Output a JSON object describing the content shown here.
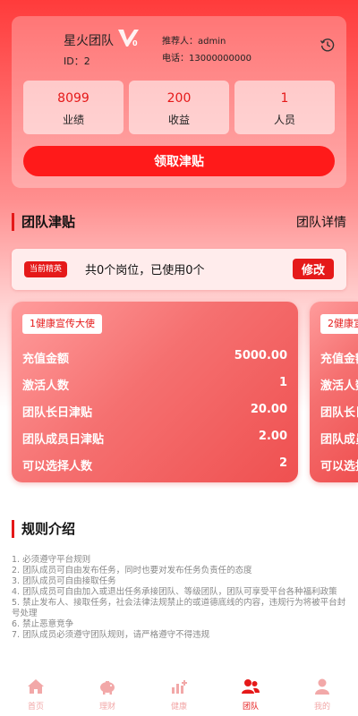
{
  "colors": {
    "primary": "#e51919",
    "button": "#ff1a1a",
    "tab_inactive": "#f2a8a8"
  },
  "header": {
    "team_name": "星火团队",
    "vip_badge": "V0",
    "team_id": "ID：2",
    "referrer": "推荐人：admin",
    "phone": "电话：13000000000",
    "history_icon": "history-clock-icon"
  },
  "stats": [
    {
      "value": "8099",
      "label": "业绩"
    },
    {
      "value": "200",
      "label": "收益"
    },
    {
      "value": "1",
      "label": "人员"
    }
  ],
  "claim_button": "领取津贴",
  "allowance_section": {
    "title": "团队津贴",
    "detail_link": "团队详情"
  },
  "quota": {
    "tag": "当前精英",
    "text": "共0个岗位，已使用0个",
    "edit_button": "修改"
  },
  "positions": [
    {
      "title": "1健康宣传大使",
      "rows": [
        {
          "key": "充值金额",
          "value": "5000.00"
        },
        {
          "key": "激活人数",
          "value": "1"
        },
        {
          "key": "团队长日津贴",
          "value": "20.00"
        },
        {
          "key": "团队成员日津贴",
          "value": "2.00"
        },
        {
          "key": "可以选择人数",
          "value": "2"
        }
      ]
    },
    {
      "title": "2健康宣传大使",
      "rows": [
        {
          "key": "充值金额",
          "value": ""
        },
        {
          "key": "激活人数",
          "value": ""
        },
        {
          "key": "团队长日津贴",
          "value": ""
        },
        {
          "key": "团队成员日津贴",
          "value": ""
        },
        {
          "key": "可以选择人数",
          "value": ""
        }
      ]
    }
  ],
  "rules_section": {
    "title": "规则介绍",
    "items": [
      "1. 必须遵守平台规则",
      "2. 团队成员可自由发布任务，同时也要对发布任务负责任的态度",
      "3. 团队成员可自由接取任务",
      "4. 团队成员可自由加入或退出任务承接团队、等级团队，团队可享受平台各种福利政策",
      "5. 禁止发布人、接取任务，社会法律法规禁止的或道德底线的内容，违规行为将被平台封号处理",
      "6. 禁止恶意竞争",
      "7. 团队成员必须遵守团队规则，请严格遵守不得违规"
    ]
  },
  "tabbar": [
    {
      "label": "首页",
      "icon": "home-icon",
      "active": false
    },
    {
      "label": "理财",
      "icon": "piggy-bank-icon",
      "active": false
    },
    {
      "label": "健康",
      "icon": "health-chart-icon",
      "active": false
    },
    {
      "label": "团队",
      "icon": "team-icon",
      "active": true
    },
    {
      "label": "我的",
      "icon": "user-icon",
      "active": false
    }
  ]
}
